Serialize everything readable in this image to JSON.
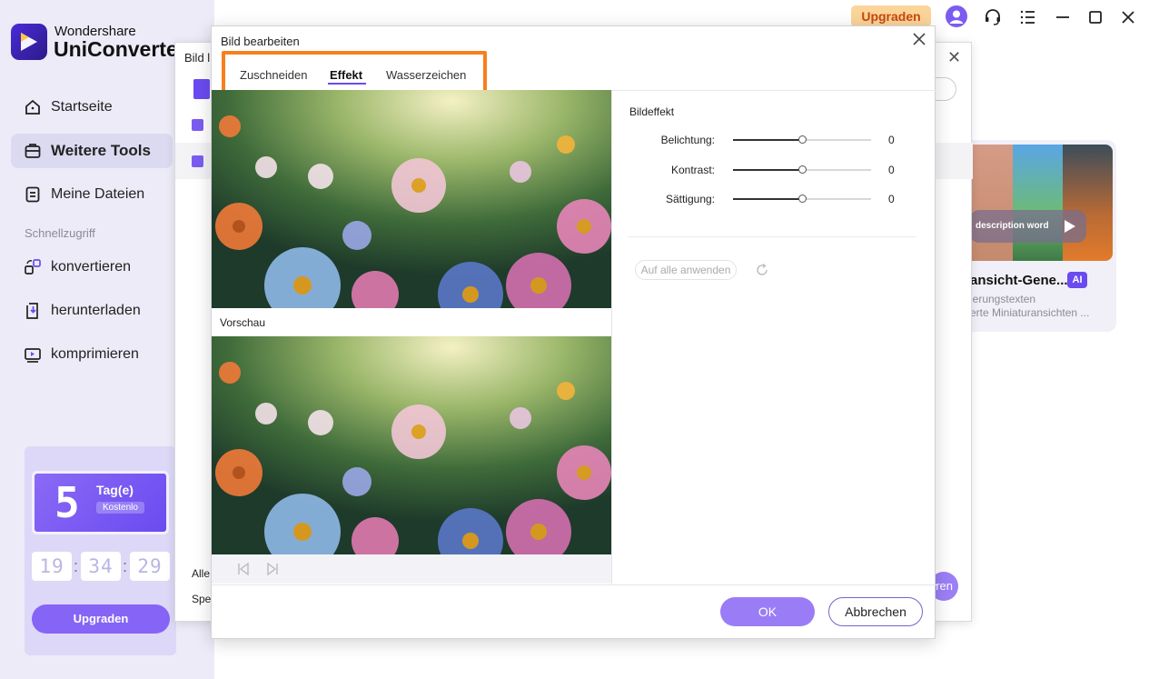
{
  "app": {
    "brand_top": "Wondershare",
    "brand_main": "UniConverter"
  },
  "sidebar": {
    "items": [
      {
        "label": "Startseite",
        "icon": "home-icon"
      },
      {
        "label": "Weitere Tools",
        "icon": "toolbox-icon",
        "active": true
      },
      {
        "label": "Meine Dateien",
        "icon": "files-icon"
      }
    ],
    "quick_label": "Schnellzugriff",
    "quick_items": [
      {
        "label": "konvertieren",
        "icon": "convert-icon"
      },
      {
        "label": "herunterladen",
        "icon": "download-icon"
      },
      {
        "label": "komprimieren",
        "icon": "compress-icon"
      }
    ]
  },
  "promo": {
    "days": "5",
    "days_label": "Tag(e)",
    "badge": "Kostenlo",
    "timer": [
      "19",
      "34",
      "29"
    ],
    "button": "Upgraden"
  },
  "topbar": {
    "upgrade": "Upgraden",
    "icons": [
      "avatar-icon",
      "headset-icon",
      "menu-icon",
      "minimize-icon",
      "maximize-icon",
      "close-icon"
    ]
  },
  "feature_card": {
    "pill_text": "description word",
    "title": "ansicht-Gene...",
    "badge": "AI",
    "desc_line1": "lerungstexten",
    "desc_line2": "erte Miniaturansichten ..."
  },
  "back_dialog": {
    "title": "Bild l",
    "label_alle": "Alle",
    "label_spe": "Spe",
    "action_partial": "ren"
  },
  "dialog": {
    "title": "Bild bearbeiten",
    "tabs": [
      {
        "label": "Zuschneiden"
      },
      {
        "label": "Effekt",
        "active": true
      },
      {
        "label": "Wasserzeichen"
      }
    ],
    "preview_label": "Vorschau",
    "section_title": "Bildeffekt",
    "sliders": [
      {
        "label": "Belichtung:",
        "value": "0",
        "position_percent": 50
      },
      {
        "label": "Kontrast:",
        "value": "0",
        "position_percent": 50
      },
      {
        "label": "Sättigung:",
        "value": "0",
        "position_percent": 50
      }
    ],
    "apply_all": "Auf alle anwenden",
    "ok": "OK",
    "cancel": "Abbrechen"
  },
  "colors": {
    "accent": "#6a4bf0",
    "highlight_frame": "#f77f1e",
    "upgrade_bg": "#fbd49a"
  }
}
